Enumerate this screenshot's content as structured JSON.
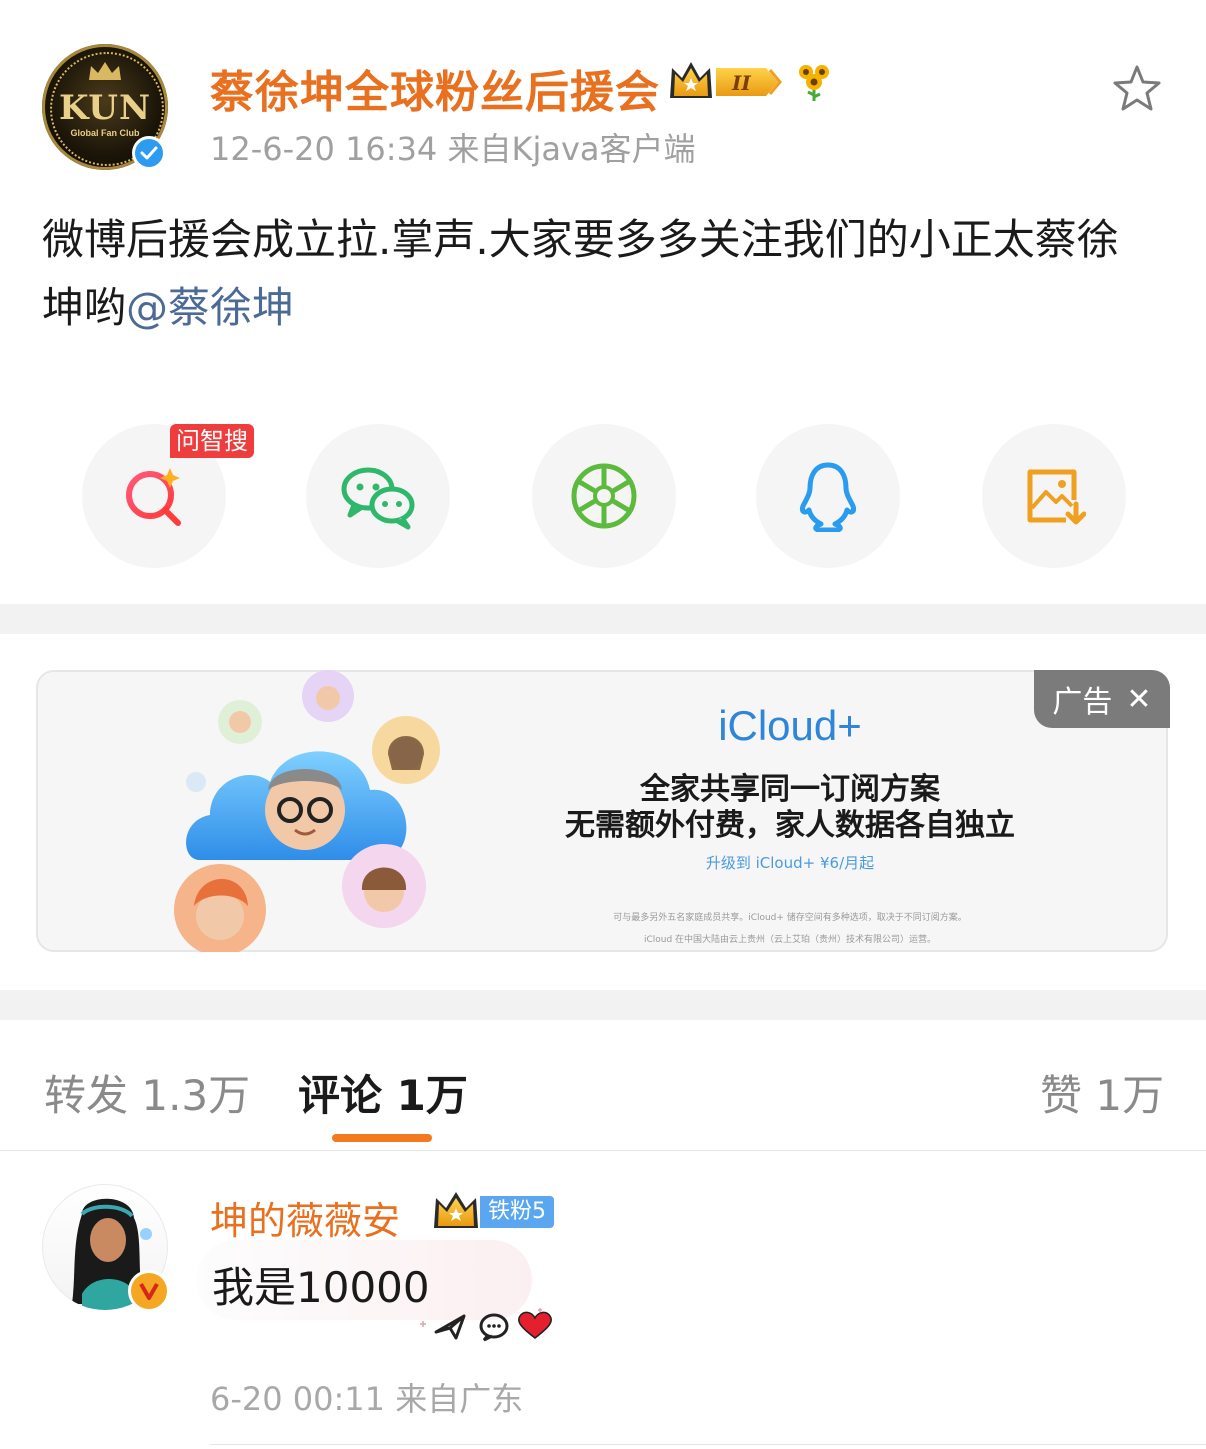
{
  "post": {
    "author": "蔡徐坤全球粉丝后援会",
    "avatar_text": "KUN",
    "avatar_subtext": "Global Fan Club",
    "meta": "12-6-20 16:34  来自Kjava客户端",
    "text": "微博后援会成立拉.掌声.大家要多多关注我们的小正太蔡徐坤哟",
    "mention": "@蔡徐坤",
    "badge_level": "II"
  },
  "share": {
    "ask_tag": "问智搜",
    "items": [
      "ask-search",
      "wechat",
      "moments",
      "qq",
      "save-image"
    ]
  },
  "ad": {
    "tag": "广告",
    "close": "✕",
    "title": "iCloud+",
    "line1": "全家共享同一订阅方案",
    "line2": "无需额外付费，家人数据各自独立",
    "upgrade": "升级到 iCloud+ ¥6/月起",
    "fine1": "可与最多另外五名家庭成员共享。iCloud+ 储存空间有多种选项，取决于不同订阅方案。",
    "fine2": "iCloud 在中国大陆由云上贵州（云上艾珀（贵州）技术有限公司）运营。"
  },
  "tabs": {
    "repost": "转发 1.3万",
    "comments": "评论 1万",
    "likes": "赞 1万"
  },
  "comment": {
    "username": "坤的薇薇安",
    "fan_badge": "铁粉5",
    "text": "我是10000",
    "meta": "6-20 00:11  来自广东"
  },
  "colors": {
    "username_orange": "#e8701f",
    "mention_blue": "#4b6a96",
    "tab_accent": "#f47a1f",
    "verified_blue": "#2d9bf0",
    "ad_blue": "#2f86d8"
  }
}
